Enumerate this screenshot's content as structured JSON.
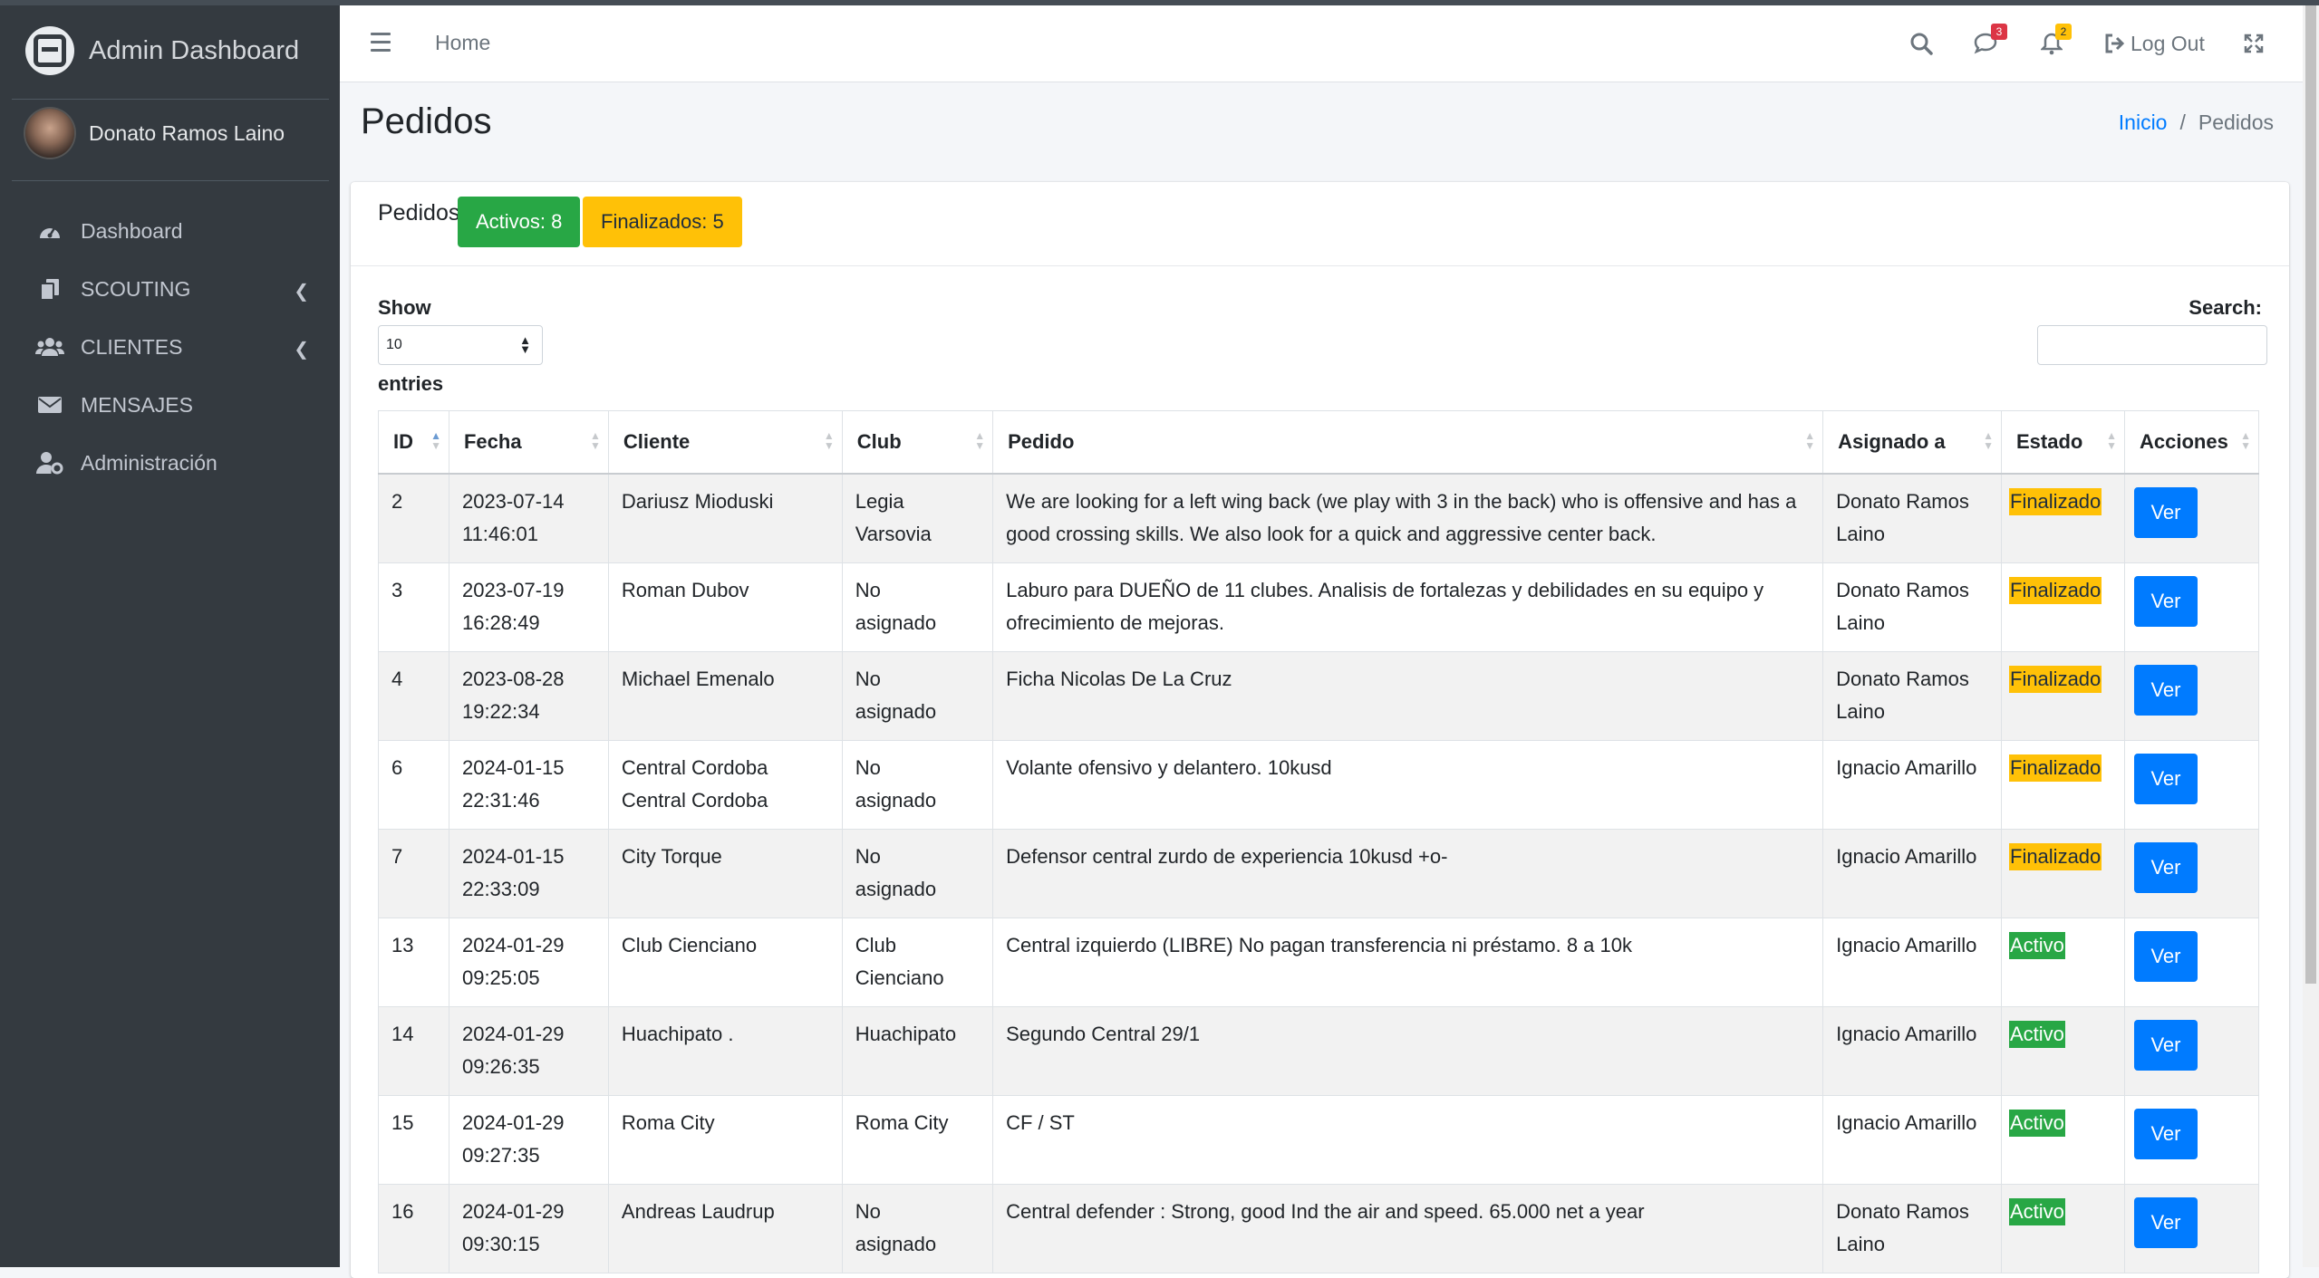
{
  "brand": {
    "title": "Admin Dashboard"
  },
  "user": {
    "name": "Donato Ramos Laino"
  },
  "sidebar": {
    "items": [
      {
        "label": "Dashboard",
        "icon": "tachometer-icon",
        "has_caret": false
      },
      {
        "label": "SCOUTING",
        "icon": "copy-icon",
        "has_caret": true
      },
      {
        "label": "CLIENTES",
        "icon": "users-icon",
        "has_caret": true
      },
      {
        "label": "MENSAJES",
        "icon": "envelope-icon",
        "has_caret": false
      },
      {
        "label": "Administración",
        "icon": "user-cog-icon",
        "has_caret": false
      }
    ]
  },
  "topbar": {
    "home": "Home",
    "messages_badge": "3",
    "notifications_badge": "2",
    "logout": "Log Out"
  },
  "page": {
    "title": "Pedidos",
    "breadcrumb": {
      "home": "Inicio",
      "separator": "/",
      "current": "Pedidos"
    }
  },
  "card": {
    "label": "Pedidos",
    "active_pill": "Activos: 8",
    "finished_pill": "Finalizados: 5"
  },
  "table_controls": {
    "show_label": "Show",
    "entries_value": "10",
    "entries_label": "entries",
    "search_label": "Search:"
  },
  "table": {
    "columns": [
      "ID",
      "Fecha",
      "Cliente",
      "Club",
      "Pedido",
      "Asignado a",
      "Estado",
      "Acciones"
    ],
    "action_label": "Ver",
    "rows": [
      {
        "id": "2",
        "fecha": "2023-07-14 11:46:01",
        "cliente": "Dariusz Mioduski",
        "club": "Legia Varsovia",
        "pedido": "We are looking for a left wing back (we play with 3 in the back) who is offensive and has a good crossing skills. We also look for a quick and aggressive center back.",
        "asignado": "Donato Ramos Laino",
        "estado": "Finalizado"
      },
      {
        "id": "3",
        "fecha": "2023-07-19 16:28:49",
        "cliente": "Roman Dubov",
        "club": "No asignado",
        "pedido": "Laburo para DUEÑO de 11 clubes. Analisis de fortalezas y debilidades en su equipo y ofrecimiento de mejoras.",
        "asignado": "Donato Ramos Laino",
        "estado": "Finalizado"
      },
      {
        "id": "4",
        "fecha": "2023-08-28 19:22:34",
        "cliente": "Michael Emenalo",
        "club": "No asignado",
        "pedido": "Ficha Nicolas De La Cruz",
        "asignado": "Donato Ramos Laino",
        "estado": "Finalizado"
      },
      {
        "id": "6",
        "fecha": "2024-01-15 22:31:46",
        "cliente": "Central Cordoba Central Cordoba",
        "club": "No asignado",
        "pedido": "Volante ofensivo y delantero. 10kusd",
        "asignado": "Ignacio Amarillo",
        "estado": "Finalizado"
      },
      {
        "id": "7",
        "fecha": "2024-01-15 22:33:09",
        "cliente": "City Torque",
        "club": "No asignado",
        "pedido": "Defensor central zurdo de experiencia 10kusd +o-",
        "asignado": "Ignacio Amarillo",
        "estado": "Finalizado"
      },
      {
        "id": "13",
        "fecha": "2024-01-29 09:25:05",
        "cliente": "Club Cienciano",
        "club": "Club Cienciano",
        "pedido": "Central izquierdo (LIBRE) No pagan transferencia ni préstamo. 8 a 10k",
        "asignado": "Ignacio Amarillo",
        "estado": "Activo"
      },
      {
        "id": "14",
        "fecha": "2024-01-29 09:26:35",
        "cliente": "Huachipato .",
        "club": "Huachipato",
        "pedido": "Segundo Central 29/1",
        "asignado": "Ignacio Amarillo",
        "estado": "Activo"
      },
      {
        "id": "15",
        "fecha": "2024-01-29 09:27:35",
        "cliente": "Roma City",
        "club": "Roma City",
        "pedido": "CF / ST",
        "asignado": "Ignacio Amarillo",
        "estado": "Activo"
      },
      {
        "id": "16",
        "fecha": "2024-01-29 09:30:15",
        "cliente": "Andreas Laudrup",
        "club": "No asignado",
        "pedido": "Central defender : Strong, good Ind the air and speed. 65.000 net a year",
        "asignado": "Donato Ramos Laino",
        "estado": "Activo"
      }
    ]
  },
  "colors": {
    "sidebar": "#343a40",
    "primary": "#007bff",
    "success": "#28a745",
    "warning": "#ffc107"
  }
}
